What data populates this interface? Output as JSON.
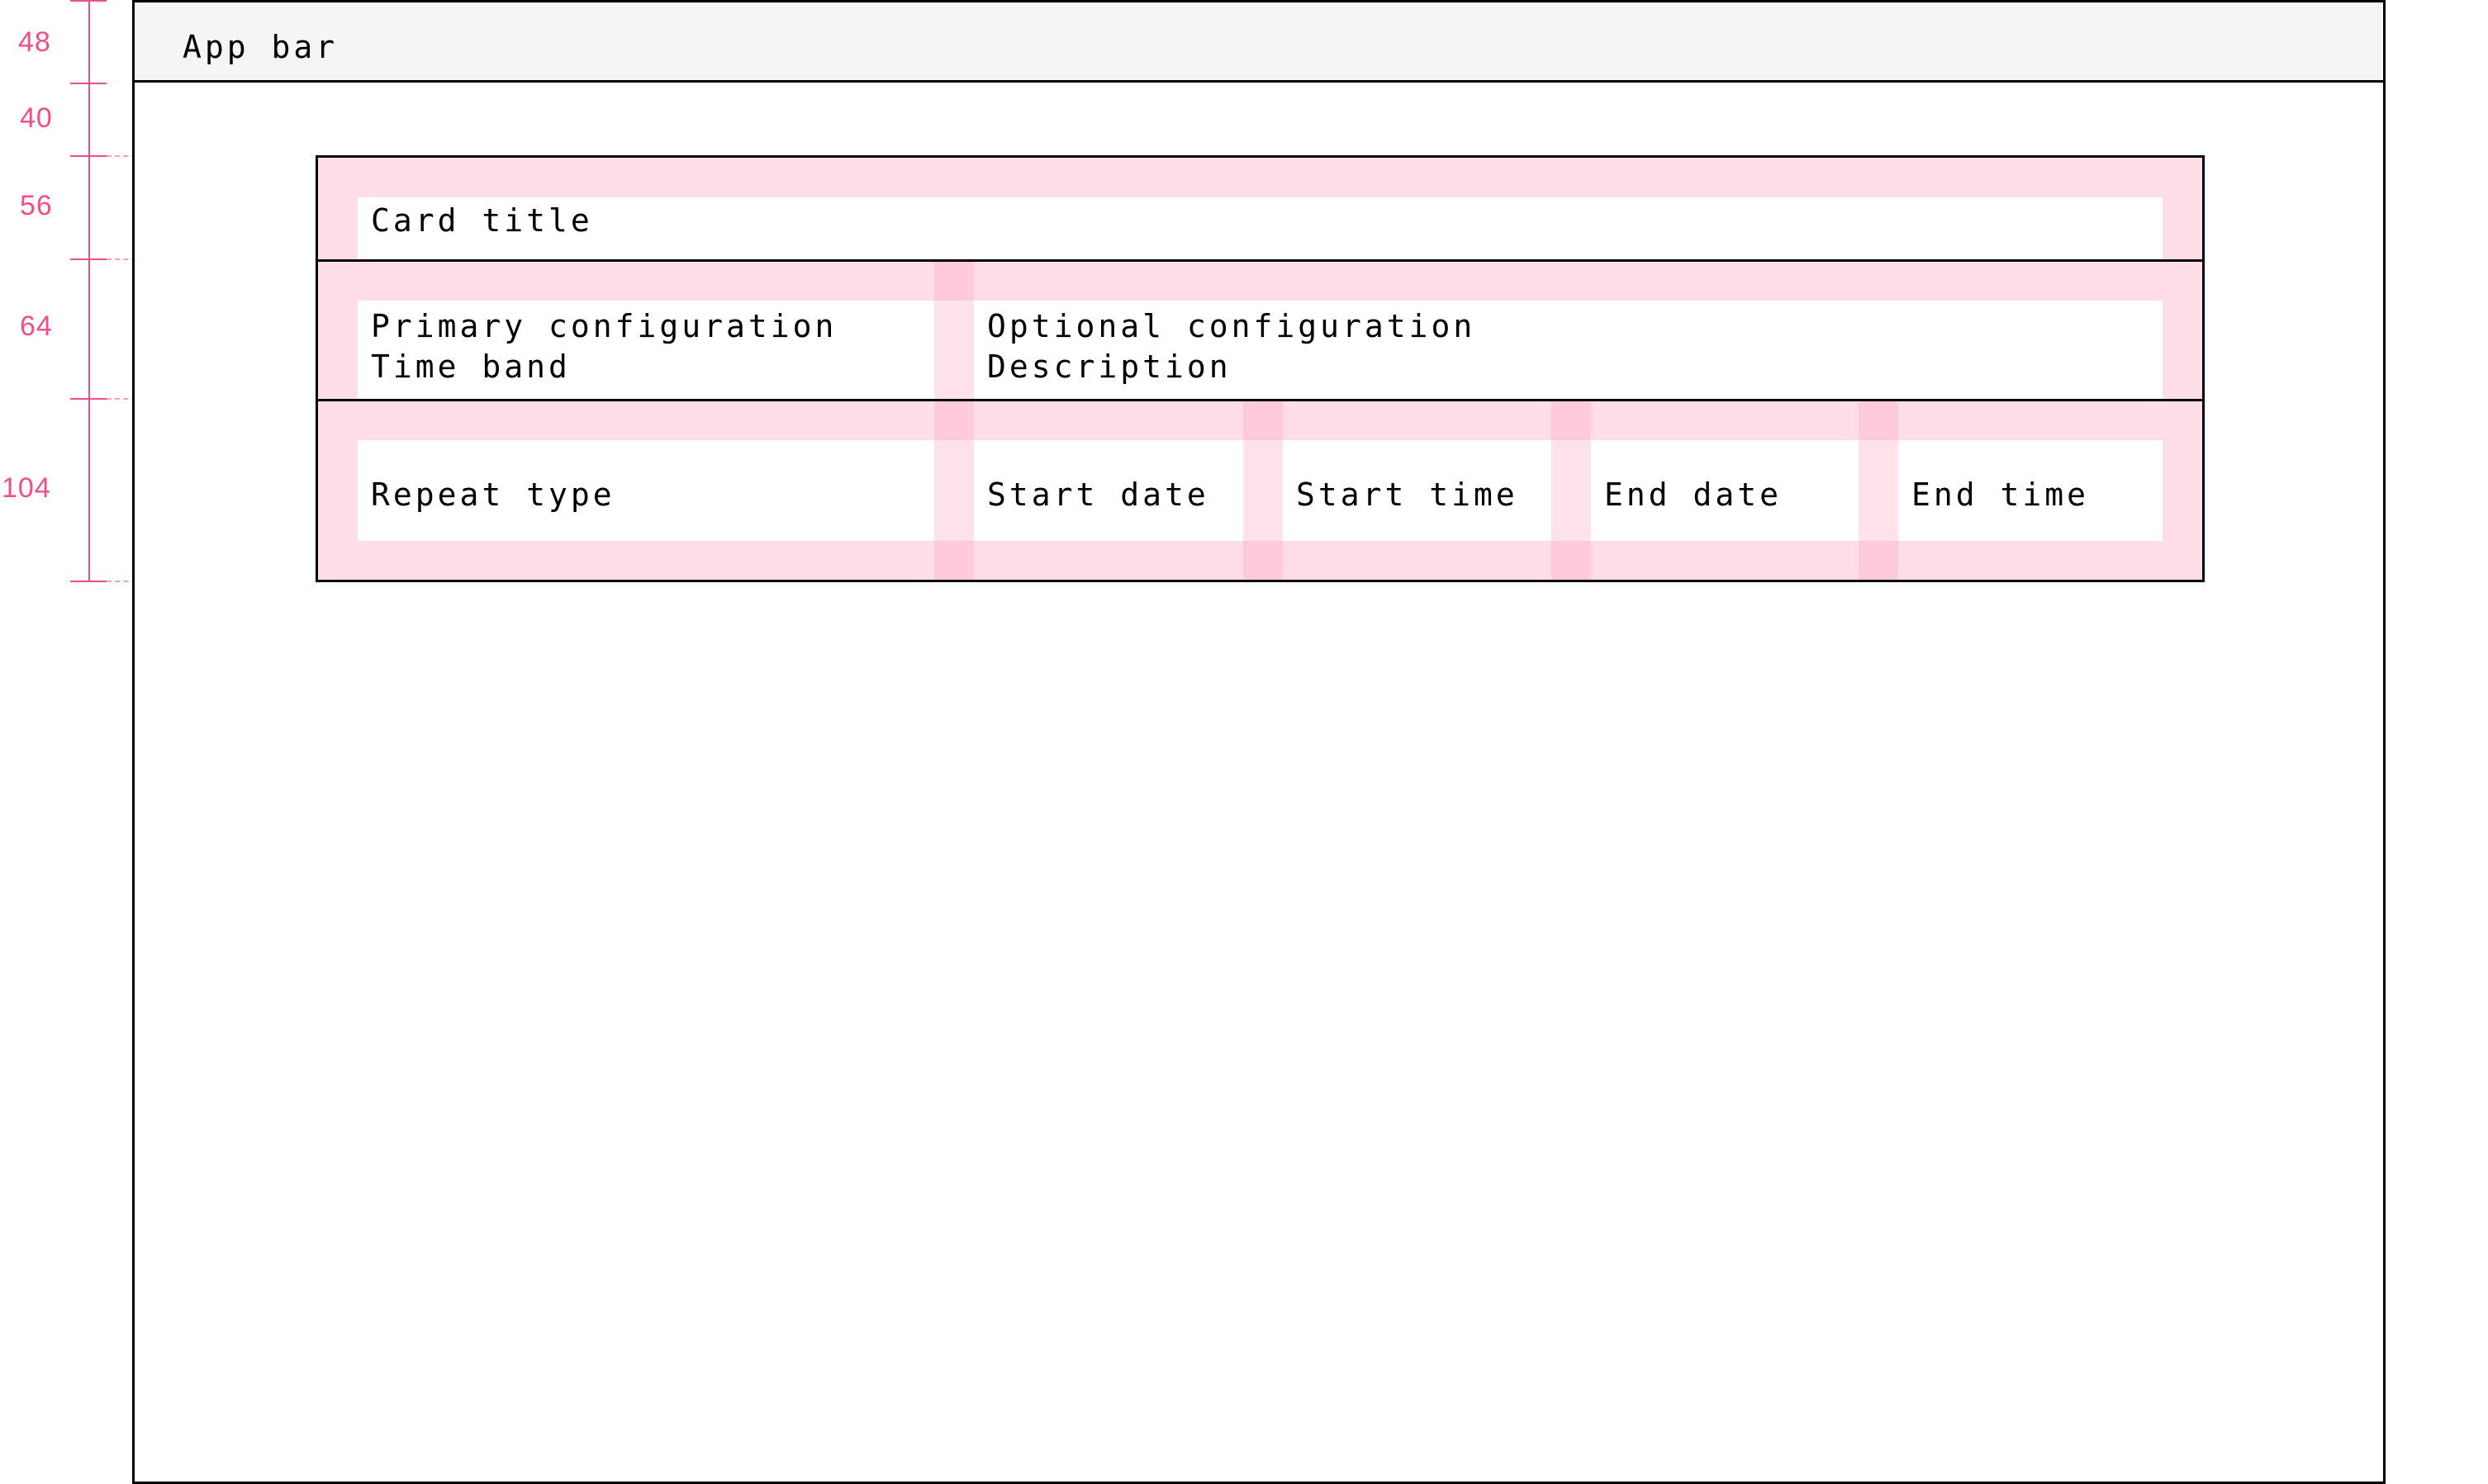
{
  "annotations": {
    "app_bar_height": "48",
    "top_spacing": "40",
    "title_row_height": "56",
    "config_row_height": "64",
    "fields_row_height": "104"
  },
  "app_bar": {
    "title": "App bar"
  },
  "card": {
    "title": "Card title",
    "primary_config": {
      "label": "Primary configuration",
      "value": "Time band"
    },
    "optional_config": {
      "label": "Optional configuration",
      "value": "Description"
    },
    "fields": [
      "Repeat type",
      "Start date",
      "Start time",
      "End date",
      "End time"
    ]
  },
  "colors": {
    "annotation": "#ef4f86",
    "grid_overlay": "#ffd6e2",
    "border": "#000000",
    "app_bar_bg": "#f5f5f5"
  }
}
